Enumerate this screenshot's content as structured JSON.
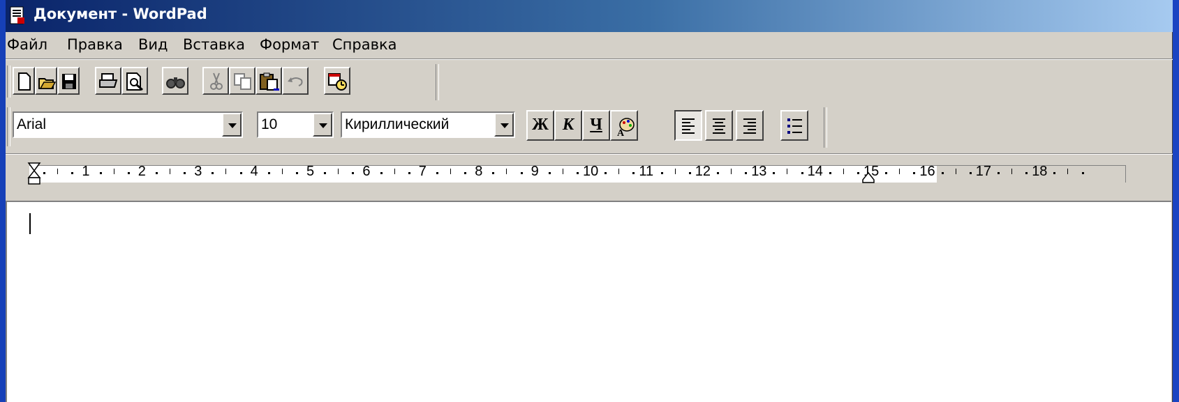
{
  "window": {
    "title": "Документ - WordPad"
  },
  "menu": {
    "items": [
      "Файл",
      "Правка",
      "Вид",
      "Вставка",
      "Формат",
      "Справка"
    ]
  },
  "toolbar": {
    "buttons": [
      "new-document-icon",
      "open-icon",
      "save-icon",
      "print-icon",
      "print-preview-icon",
      "find-icon",
      "cut-icon",
      "copy-icon",
      "paste-icon",
      "undo-icon",
      "insert-datetime-icon"
    ]
  },
  "format_bar": {
    "font_name": "Arial",
    "font_size": "10",
    "script": "Кириллический",
    "bold_label": "Ж",
    "italic_label": "К",
    "underline_label": "Ч",
    "alignment_selected": "left"
  },
  "ruler": {
    "numbers": [
      "1",
      "2",
      "3",
      "4",
      "5",
      "6",
      "7",
      "8",
      "9",
      "10",
      "11",
      "12",
      "13",
      "14",
      "15",
      "16",
      "17",
      "18"
    ]
  },
  "editor": {
    "content": ""
  },
  "colors": {
    "titlebar_start": "#0a246a",
    "titlebar_end": "#a6caf0",
    "face": "#d4d0c8"
  }
}
